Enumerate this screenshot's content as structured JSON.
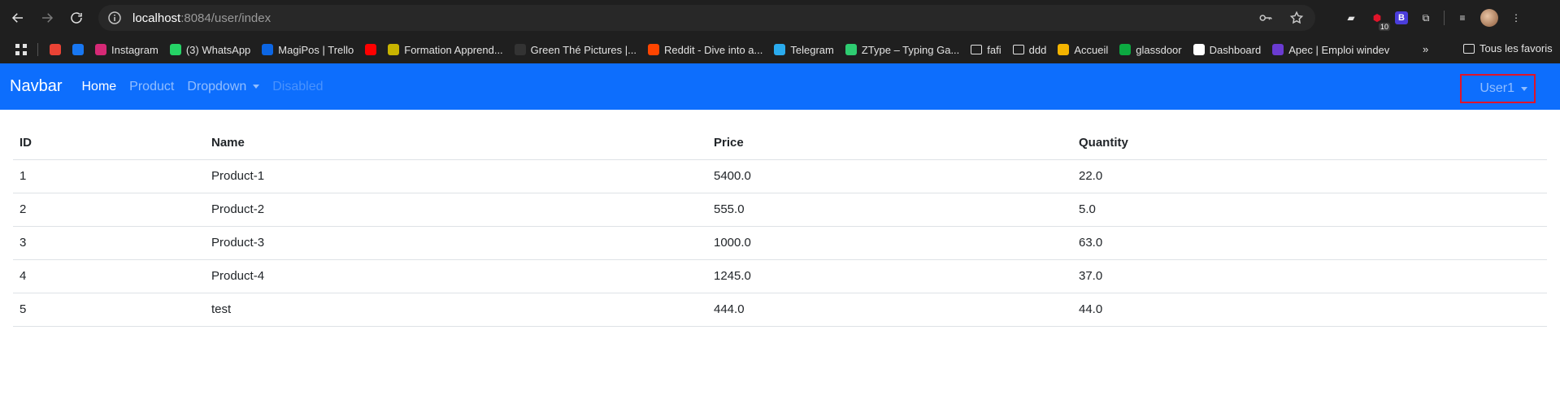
{
  "browser": {
    "url_host": "localhost",
    "url_rest": ":8084/user/index",
    "badge_count": "10",
    "brand_ext_letter": "B"
  },
  "bookmarks": {
    "items": [
      {
        "label": "",
        "color": "#ea4335"
      },
      {
        "label": "",
        "color": "#1877f2"
      },
      {
        "label": "Instagram",
        "color": "#d62976"
      },
      {
        "label": "(3) WhatsApp",
        "color": "#25d366"
      },
      {
        "label": "MagiPos | Trello",
        "color": "#0c66e4"
      },
      {
        "label": "",
        "color": "#ff0000"
      },
      {
        "label": "Formation Appre­nd...",
        "color": "#c8b400"
      },
      {
        "label": "Green Thé Pictures |...",
        "color": "#333333"
      },
      {
        "label": "Reddit - Dive into a...",
        "color": "#ff4500"
      },
      {
        "label": "Telegram",
        "color": "#2aabee"
      },
      {
        "label": "ZType – Typing Ga...",
        "color": "#2ecc71"
      },
      {
        "label": "fafi",
        "color": "folder"
      },
      {
        "label": "ddd",
        "color": "folder"
      },
      {
        "label": "Accueil",
        "color": "#f4b400"
      },
      {
        "label": "glassdoor",
        "color": "#0caa41"
      },
      {
        "label": "Dashboard",
        "color": "#ffffff"
      },
      {
        "label": "Apec | Emploi windev",
        "color": "#6a3bd1"
      }
    ],
    "more": "»",
    "all_bookmarks": "Tous les favoris"
  },
  "navbar": {
    "brand": "Navbar",
    "links": [
      "Home",
      "Product",
      "Dropdown",
      "Disabled"
    ],
    "user": "User1",
    "bg_color": "#0d6efd"
  },
  "table": {
    "headers": [
      "ID",
      "Name",
      "Price",
      "Quantity"
    ],
    "rows": [
      [
        "1",
        "Product-1",
        "5400.0",
        "22.0"
      ],
      [
        "2",
        "Product-2",
        "555.0",
        "5.0"
      ],
      [
        "3",
        "Product-3",
        "1000.0",
        "63.0"
      ],
      [
        "4",
        "Product-4",
        "1245.0",
        "37.0"
      ],
      [
        "5",
        "test",
        "444.0",
        "44.0"
      ]
    ]
  }
}
